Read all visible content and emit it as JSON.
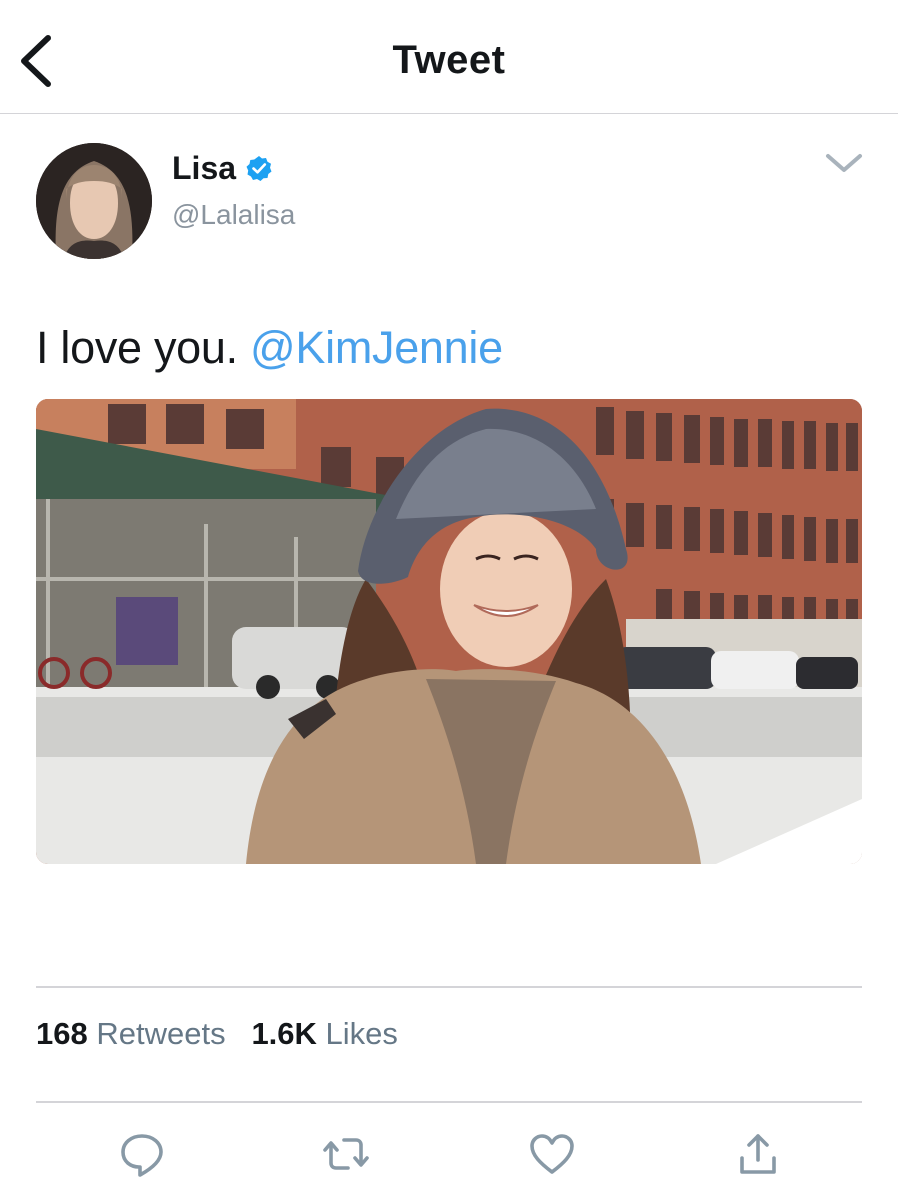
{
  "header": {
    "title": "Tweet",
    "back_icon": "chevron-left-icon"
  },
  "tweet": {
    "author": {
      "name": "Lisa",
      "handle": "@Lalalisa",
      "verified": true
    },
    "text": "I love you.",
    "mention": "@KimJennie",
    "media": {
      "type": "photo"
    }
  },
  "stats": {
    "retweets_count": "168",
    "retweets_label": "Retweets",
    "likes_count": "1.6K",
    "likes_label": "Likes"
  },
  "actions": [
    "reply-icon",
    "retweet-icon",
    "like-icon",
    "share-icon"
  ],
  "colors": {
    "link": "#4aa1eb",
    "verified": "#1da1f2",
    "icon": "#8899a6",
    "divider": "#d4d4d8"
  }
}
